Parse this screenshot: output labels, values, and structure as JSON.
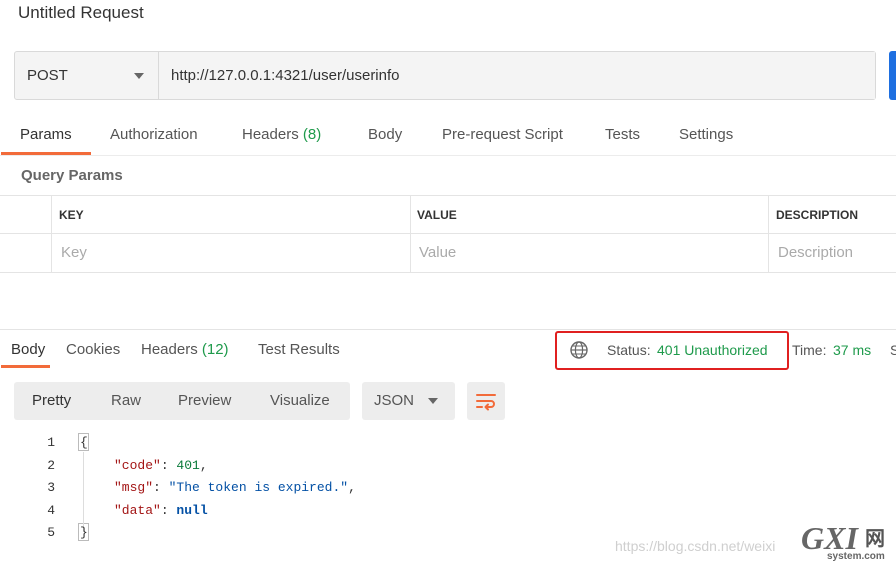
{
  "request": {
    "title": "Untitled Request",
    "method": "POST",
    "url": "http://127.0.0.1:4321/user/userinfo"
  },
  "request_tabs": {
    "params": "Params",
    "authorization": "Authorization",
    "headers": "Headers",
    "headers_count": "(8)",
    "body": "Body",
    "pre_request": "Pre-request Script",
    "tests": "Tests",
    "settings": "Settings"
  },
  "query_params": {
    "label": "Query Params",
    "columns": [
      "KEY",
      "VALUE",
      "DESCRIPTION"
    ],
    "placeholders": [
      "Key",
      "Value",
      "Description"
    ]
  },
  "response_tabs": {
    "body": "Body",
    "cookies": "Cookies",
    "headers": "Headers",
    "headers_count": "(12)",
    "test_results": "Test Results"
  },
  "status": {
    "label": "Status:",
    "value": "401 Unauthorized",
    "time_label": "Time:",
    "time_value": "37 ms",
    "size_label_clipped": "S"
  },
  "view": {
    "modes": [
      "Pretty",
      "Raw",
      "Preview",
      "Visualize"
    ],
    "format": "JSON"
  },
  "response_body": {
    "line_numbers": [
      "1",
      "2",
      "3",
      "4",
      "5"
    ],
    "open_brace": "{",
    "close_brace": "}",
    "fields": [
      {
        "key": "\"code\"",
        "value": "401",
        "trail": ","
      },
      {
        "key": "\"msg\"",
        "value": "\"The token is expired.\"",
        "trail": ","
      },
      {
        "key": "\"data\"",
        "value": "null",
        "trail": ""
      }
    ]
  },
  "watermark": "https://blog.csdn.net/weixi",
  "logo": {
    "text_main": "GXI",
    "text_cn": "网",
    "text_sub": "system.com"
  },
  "colors": {
    "accent_tab": "#f26b3a",
    "status_ok_text": "#1e9a4b",
    "highlight_box": "#e02020",
    "send_button": "#1e6fe0"
  }
}
